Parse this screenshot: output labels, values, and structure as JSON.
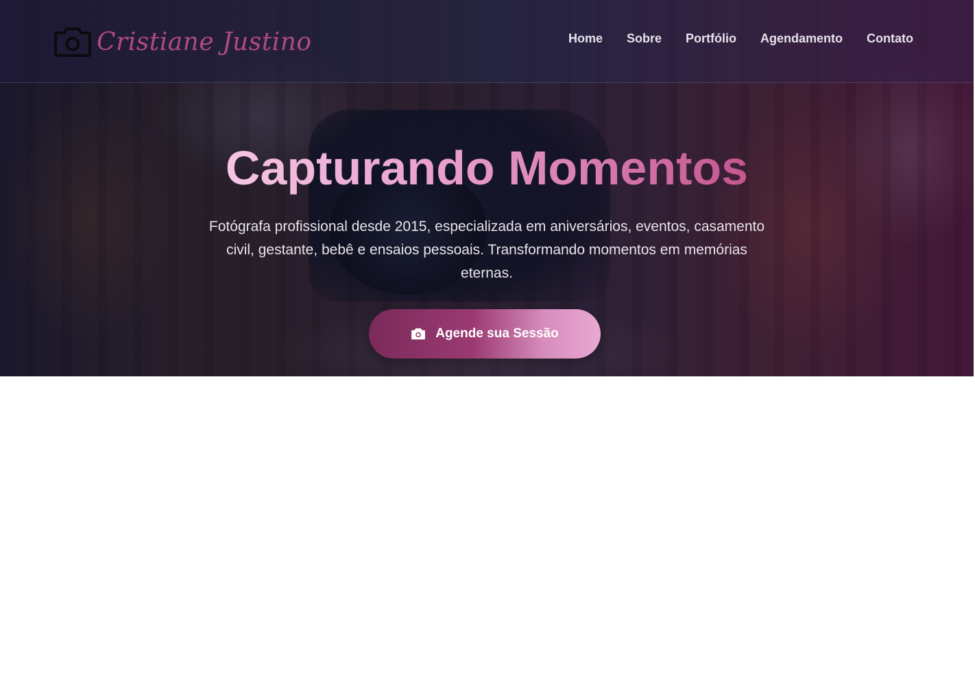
{
  "brand": {
    "name": "Cristiane Justino",
    "icon": "camera-icon"
  },
  "nav": {
    "items": [
      {
        "label": "Home"
      },
      {
        "label": "Sobre"
      },
      {
        "label": "Portfólio"
      },
      {
        "label": "Agendamento"
      },
      {
        "label": "Contato"
      }
    ]
  },
  "hero": {
    "title": "Capturando Momentos",
    "subtitle": "Fotógrafa profissional desde 2015, especializada em aniversários, eventos, casamento civil, gestante, bebê e ensaios pessoais. Transformando momentos em memórias eternas.",
    "cta": {
      "label": "Agende sua Sessão",
      "icon": "camera-icon"
    }
  },
  "colors": {
    "brand_pink": "#b04a86",
    "title_gradient_start": "#f5c6e4",
    "title_gradient_end": "#c4568f",
    "cta_gradient_start": "#7a2a5a",
    "cta_gradient_end": "#eaa8d2",
    "nav_text": "#e8e2ec"
  }
}
